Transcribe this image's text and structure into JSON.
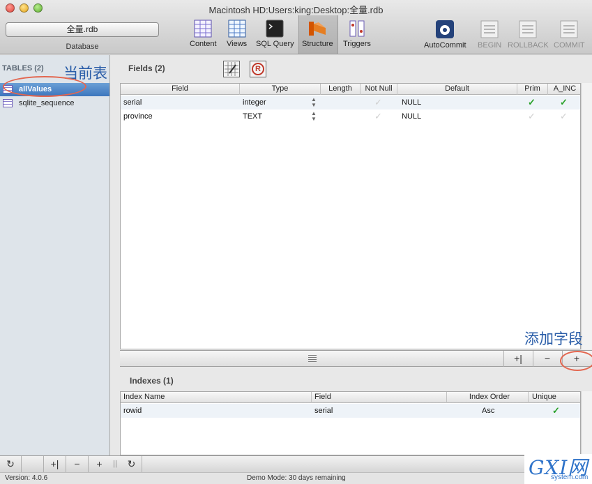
{
  "window": {
    "title": "Macintosh HD:Users:king:Desktop:全量.rdb"
  },
  "database": {
    "selected": "全量.rdb",
    "label": "Database"
  },
  "toolbar": {
    "content": "Content",
    "views": "Views",
    "sql_query": "SQL Query",
    "structure": "Structure",
    "triggers": "Triggers",
    "autocommit": "AutoCommit",
    "begin": "BEGIN",
    "rollback": "ROLLBACK",
    "commit": "COMMIT"
  },
  "sidebar": {
    "header": "TABLES (2)",
    "tables": [
      "allValues",
      "sqlite_sequence"
    ]
  },
  "annotations": {
    "current_table": "当前表",
    "add_field": "添加字段"
  },
  "fields": {
    "header": "Fields (2)",
    "columns": [
      "Field",
      "Type",
      "Length",
      "Not Null",
      "Default",
      "Prim",
      "A_INC"
    ],
    "rows": [
      {
        "field": "serial",
        "type": "integer",
        "length": "",
        "not_null": false,
        "default": "NULL",
        "prim": true,
        "a_inc": true
      },
      {
        "field": "province",
        "type": "TEXT",
        "length": "",
        "not_null": false,
        "default": "NULL",
        "prim": false,
        "a_inc": false
      }
    ]
  },
  "indexes": {
    "header": "Indexes (1)",
    "columns": [
      "Index Name",
      "Field",
      "Index Order",
      "Unique"
    ],
    "rows": [
      {
        "name": "rowid",
        "field": "serial",
        "order": "Asc",
        "unique": true
      }
    ]
  },
  "status": {
    "version": "Version: 4.0.6",
    "demo": "Demo Mode: 30 days remaining"
  },
  "watermark": {
    "text": "GXI网",
    "sub": "system.com"
  },
  "colors": {
    "selection": "#3c76bd",
    "check": "#27a027",
    "annotation": "#2a5da8",
    "highlight_ring": "#e3664f"
  }
}
